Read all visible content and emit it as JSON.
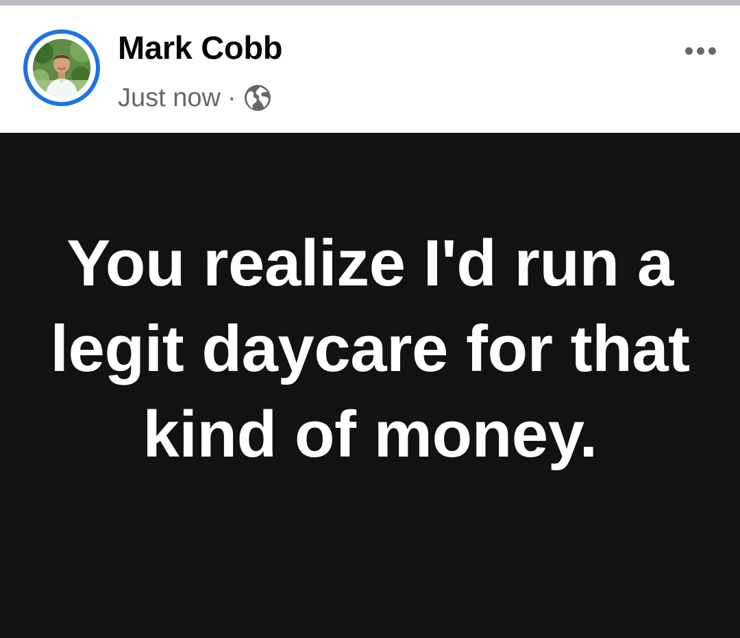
{
  "post": {
    "author": "Mark Cobb",
    "timestamp": "Just now",
    "separator": "·",
    "audience_icon": "globe-icon",
    "more_icon": "more-options-icon",
    "text": "You realize I'd run a legit daycare for that kind of money."
  },
  "colors": {
    "story_ring": "#1b74e4",
    "post_background": "#121212",
    "post_text": "#ffffff",
    "secondary_text": "#65676b"
  }
}
